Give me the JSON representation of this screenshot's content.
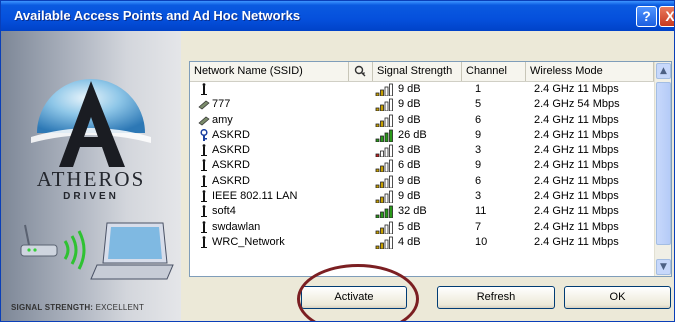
{
  "window": {
    "title": "Available Access Points and Ad Hoc Networks",
    "help_label": "?",
    "close_label": "X"
  },
  "brand": {
    "name": "ATHEROS",
    "tagline": "DRIVEN"
  },
  "signal_status": {
    "label": "SIGNAL STRENGTH:",
    "value": "EXCELLENT"
  },
  "columns": [
    "Network Name (SSID)",
    "",
    "Signal Strength",
    "Channel",
    "Wireless Mode"
  ],
  "networks": [
    {
      "ssid": "",
      "icon": "antenna-icon",
      "bars": 2,
      "bar_color": "#c8a000",
      "signal": "9 dB",
      "channel": "1",
      "mode": "2.4 GHz 11 Mbps"
    },
    {
      "ssid": "777",
      "icon": "adhoc-icon",
      "bars": 2,
      "bar_color": "#c8a000",
      "signal": "9 dB",
      "channel": "5",
      "mode": "2.4 GHz 54 Mbps"
    },
    {
      "ssid": "amy",
      "icon": "adhoc-icon",
      "bars": 2,
      "bar_color": "#c8a000",
      "signal": "9 dB",
      "channel": "6",
      "mode": "2.4 GHz 11 Mbps"
    },
    {
      "ssid": "ASKRD",
      "icon": "secure-icon",
      "bars": 4,
      "bar_color": "#2a9a1a",
      "signal": "26 dB",
      "channel": "9",
      "mode": "2.4 GHz 11 Mbps"
    },
    {
      "ssid": "ASKRD",
      "icon": "antenna-icon",
      "bars": 1,
      "bar_color": "#c02020",
      "signal": "3 dB",
      "channel": "3",
      "mode": "2.4 GHz 11 Mbps"
    },
    {
      "ssid": "ASKRD",
      "icon": "antenna-icon",
      "bars": 2,
      "bar_color": "#c8a000",
      "signal": "6 dB",
      "channel": "9",
      "mode": "2.4 GHz 11 Mbps"
    },
    {
      "ssid": "ASKRD",
      "icon": "antenna-icon",
      "bars": 2,
      "bar_color": "#c8a000",
      "signal": "9 dB",
      "channel": "6",
      "mode": "2.4 GHz 11 Mbps"
    },
    {
      "ssid": "IEEE 802.11 LAN",
      "icon": "antenna-icon",
      "bars": 2,
      "bar_color": "#c8a000",
      "signal": "9 dB",
      "channel": "3",
      "mode": "2.4 GHz 11 Mbps"
    },
    {
      "ssid": "soft4",
      "icon": "antenna-icon",
      "bars": 4,
      "bar_color": "#2a9a1a",
      "signal": "32 dB",
      "channel": "11",
      "mode": "2.4 GHz 11 Mbps"
    },
    {
      "ssid": "swdawlan",
      "icon": "antenna-icon",
      "bars": 2,
      "bar_color": "#c8a000",
      "signal": "5 dB",
      "channel": "7",
      "mode": "2.4 GHz 11 Mbps"
    },
    {
      "ssid": "WRC_Network",
      "icon": "antenna-icon",
      "bars": 2,
      "bar_color": "#c8a000",
      "signal": "4 dB",
      "channel": "10",
      "mode": "2.4 GHz 11 Mbps"
    }
  ],
  "buttons": {
    "activate": "Activate",
    "refresh": "Refresh",
    "ok": "OK"
  }
}
